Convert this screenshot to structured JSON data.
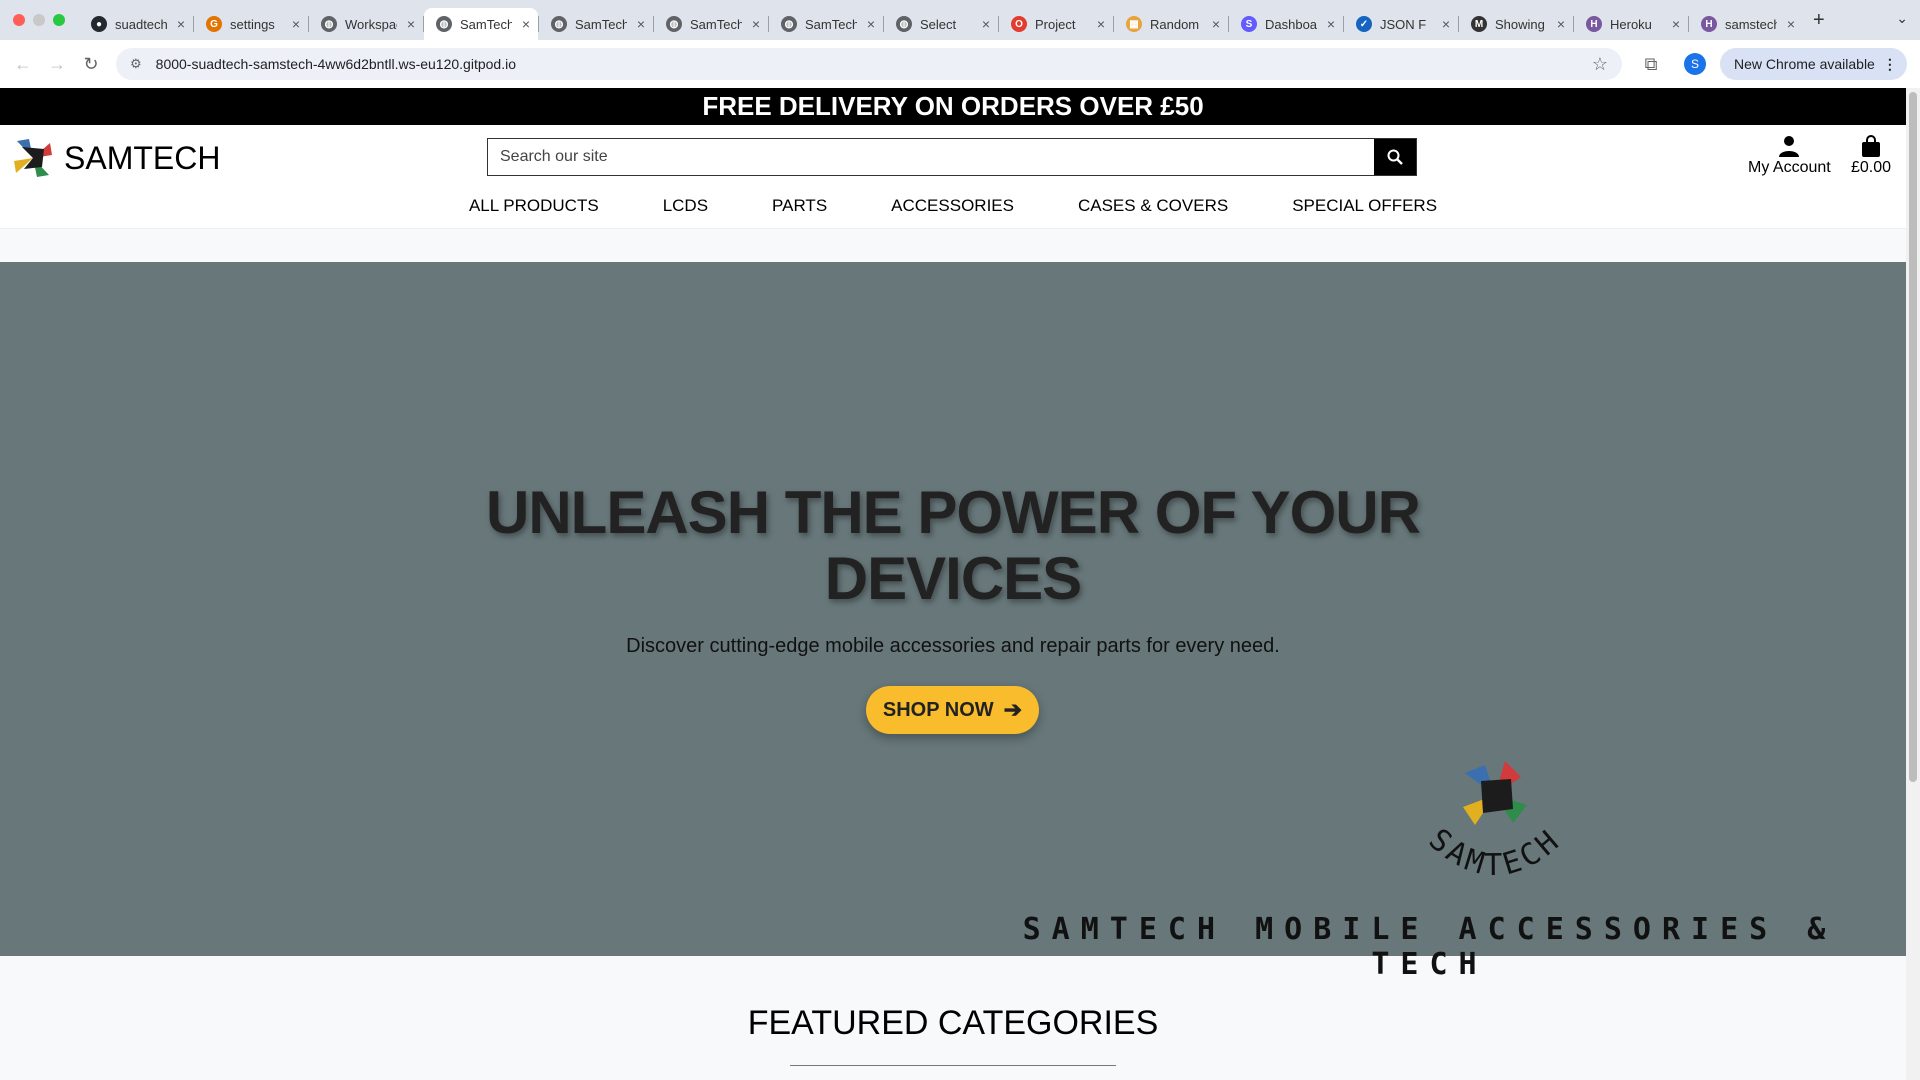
{
  "browser": {
    "tabs": [
      {
        "label": "suadtech",
        "icon": "github-icon",
        "color": "#24292f",
        "active": false
      },
      {
        "label": "settings",
        "icon": "google-icon",
        "color": "#e37400",
        "active": false
      },
      {
        "label": "Workspaces",
        "icon": "globe-icon",
        "color": "#5f6368",
        "active": false
      },
      {
        "label": "SamTech",
        "icon": "globe-icon",
        "color": "#5f6368",
        "active": true
      },
      {
        "label": "SamTech",
        "icon": "globe-icon",
        "color": "#5f6368",
        "active": false
      },
      {
        "label": "SamTech",
        "icon": "globe-icon",
        "color": "#5f6368",
        "active": false
      },
      {
        "label": "SamTech",
        "icon": "globe-icon",
        "color": "#5f6368",
        "active": false
      },
      {
        "label": "Select",
        "icon": "globe-icon",
        "color": "#5f6368",
        "active": false
      },
      {
        "label": "Project",
        "icon": "opera-icon",
        "color": "#e33b2e",
        "active": false
      },
      {
        "label": "Random",
        "icon": "picture-icon",
        "color": "#e8a33d",
        "active": false
      },
      {
        "label": "Dashboard",
        "icon": "stripe-icon",
        "color": "#635bff",
        "active": false
      },
      {
        "label": "JSON F",
        "icon": "checkbox-icon",
        "color": "#1565c0",
        "active": false
      },
      {
        "label": "Showing",
        "icon": "bird-icon",
        "color": "#333333",
        "active": false
      },
      {
        "label": "Heroku",
        "icon": "heroku-icon",
        "color": "#79589f",
        "active": false
      },
      {
        "label": "samstech",
        "icon": "heroku-icon",
        "color": "#79589f",
        "active": false
      }
    ],
    "url": "8000-suadtech-samstech-4ww6d2bntll.ws-eu120.gitpod.io",
    "profile_initial": "S",
    "update_label": "New Chrome available"
  },
  "site": {
    "promo": "FREE DELIVERY ON ORDERS OVER £50",
    "brand": "SAMTECH",
    "search_placeholder": "Search our site",
    "account_label": "My Account",
    "cart_total": "£0.00",
    "nav": [
      "ALL PRODUCTS",
      "LCDS",
      "PARTS",
      "ACCESSORIES",
      "CASES & COVERS",
      "SPECIAL OFFERS"
    ],
    "hero": {
      "title_line1": "UNLEASH THE POWER OF YOUR",
      "title_line2": "DEVICES",
      "subtitle": "Discover cutting-edge mobile accessories and repair parts for every need.",
      "cta": "SHOP NOW",
      "logo_text": "SAMTECH",
      "tagline": "SAMTECH MOBILE ACCESSORIES & TECH"
    },
    "featured_title": "FEATURED CATEGORIES"
  },
  "colors": {
    "hero_bg": "#67777a",
    "cta_bg": "#f8bc2c",
    "promo_bg": "#000000"
  }
}
